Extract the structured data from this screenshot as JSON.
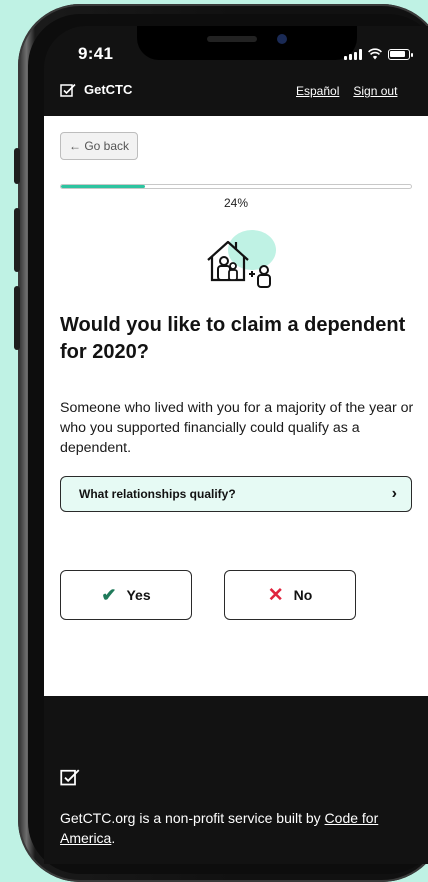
{
  "status_bar": {
    "time": "9:41"
  },
  "header": {
    "brand": "GetCTC",
    "links": [
      "Español",
      "Sign out"
    ]
  },
  "page": {
    "back_label": "← Go back",
    "progress": {
      "value": 24,
      "label": "24%"
    },
    "illustration_icon": "house-with-dependent-icon",
    "question": "Would you like to claim a dependent for 2020?",
    "help_text": "Someone who lived with you for a majority of the year or who you supported financially could qualify as a dependent.",
    "accordion": {
      "label": "What relationships qualify?",
      "chevron": "›"
    },
    "choices": {
      "yes": {
        "label": "Yes",
        "icon": "✔"
      },
      "no": {
        "label": "No",
        "icon": "✕"
      }
    }
  },
  "footer": {
    "text_prefix": "GetCTC.org is a non-profit service built by ",
    "link_text": "Code for America",
    "text_suffix": "."
  },
  "colors": {
    "background": "#bff2e4",
    "accent": "#2dc4a0",
    "dark": "#121212",
    "no_red": "#e0243e",
    "yes_green": "#1f7a5a"
  }
}
